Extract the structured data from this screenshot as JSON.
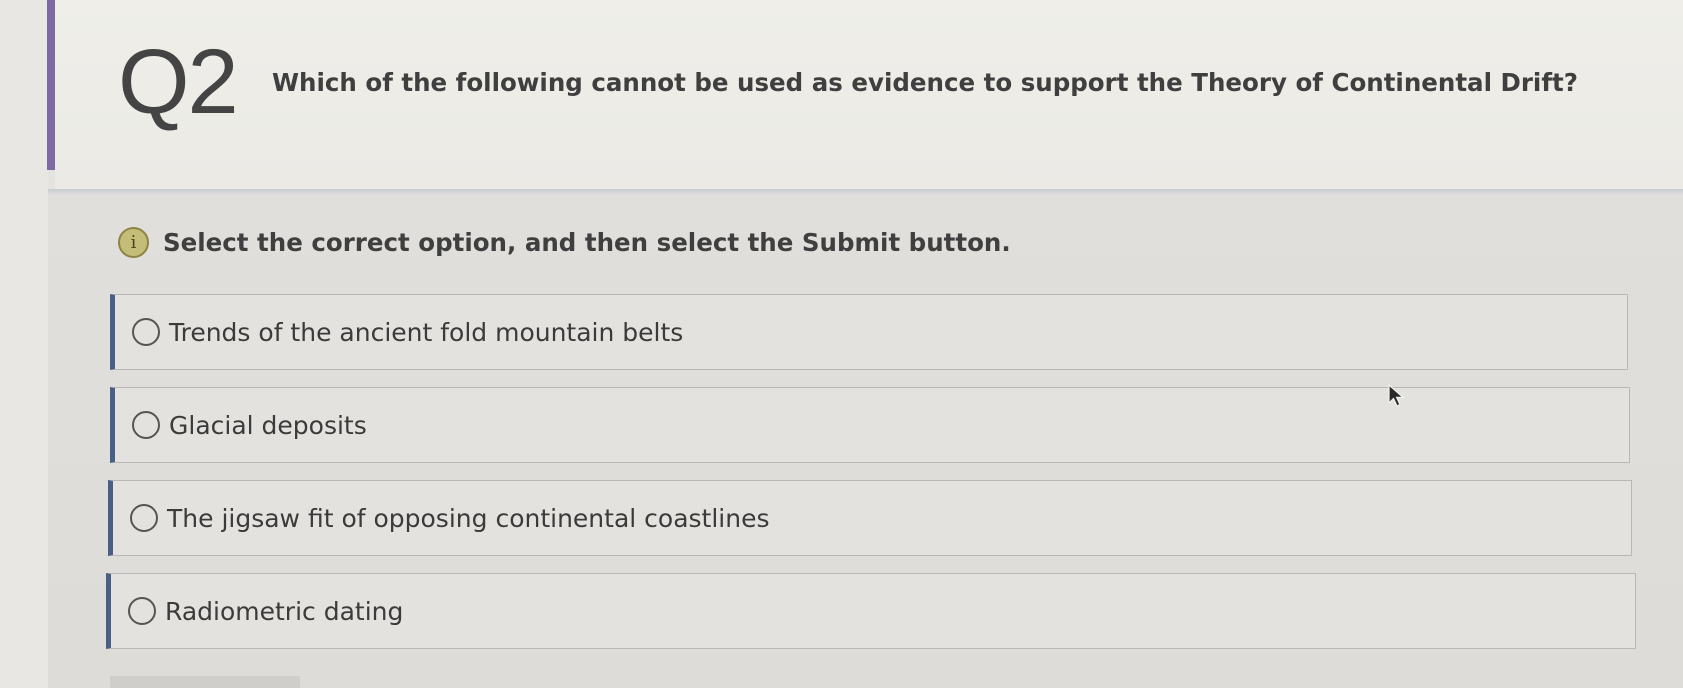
{
  "question": {
    "number": "Q2",
    "text": "Which of the following cannot be used as evidence to support the Theory of Continental Drift?"
  },
  "instruction": {
    "icon": "info-icon",
    "icon_glyph": "i",
    "text": "Select the correct option, and then select the Submit button."
  },
  "options": [
    {
      "label": "Trends of the ancient fold mountain belts",
      "selected": false
    },
    {
      "label": "Glacial deposits",
      "selected": false
    },
    {
      "label": "The jigsaw fit of opposing continental coastlines",
      "selected": false
    },
    {
      "label": "Radiometric dating",
      "selected": false
    }
  ],
  "colors": {
    "accent": "#7d6aa3",
    "option_border": "#4a5f86",
    "info_icon": "#c3bd78"
  }
}
